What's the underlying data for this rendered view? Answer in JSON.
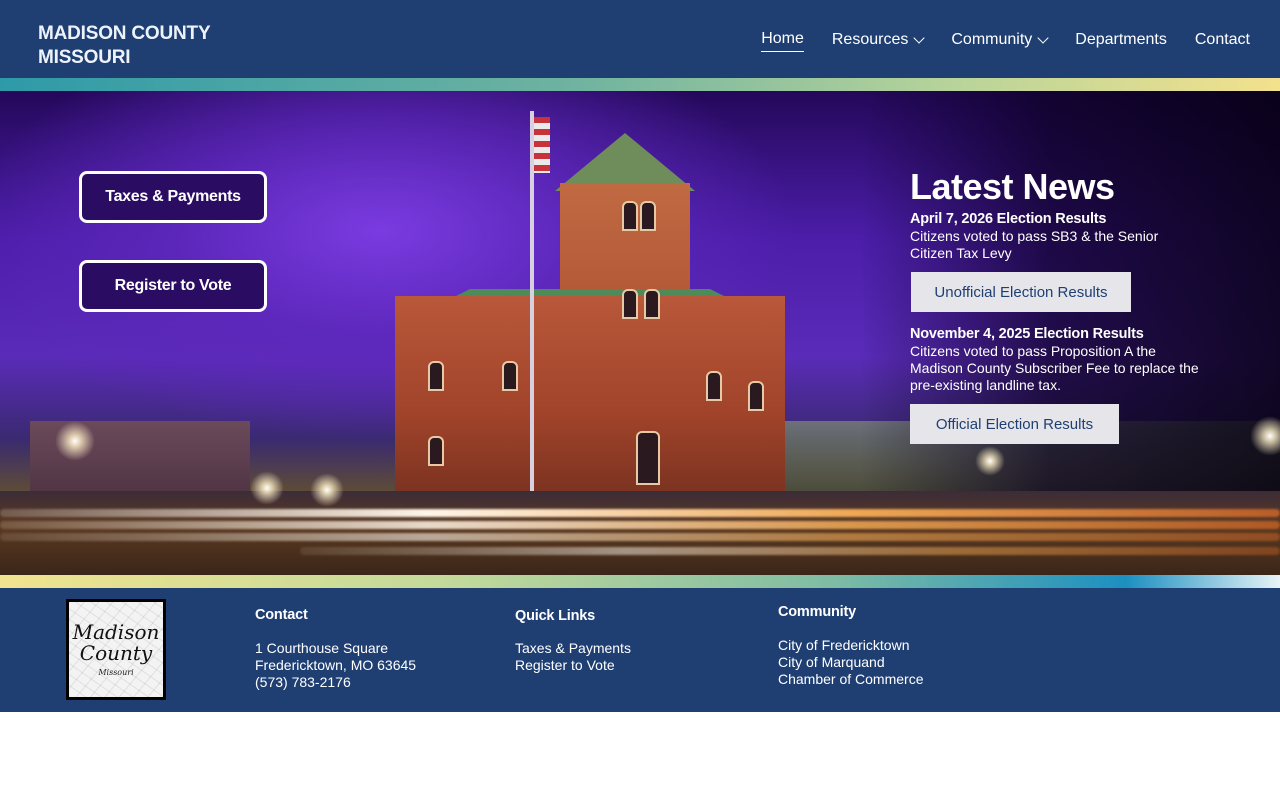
{
  "header": {
    "logo_line1": "MADISON COUNTY",
    "logo_line2": "MISSOURI",
    "nav": [
      {
        "label": "Home",
        "active": true,
        "dropdown": false
      },
      {
        "label": "Resources",
        "active": false,
        "dropdown": true
      },
      {
        "label": "Community",
        "active": false,
        "dropdown": true
      },
      {
        "label": "Departments",
        "active": false,
        "dropdown": false
      },
      {
        "label": "Contact",
        "active": false,
        "dropdown": false
      }
    ]
  },
  "hero": {
    "buttons": [
      "Taxes & Payments",
      "Register to Vote"
    ],
    "news": {
      "title": "Latest News",
      "items": [
        {
          "date": "April 7, 2026 Election Results",
          "text": "Citizens voted to pass SB3 & the Senior Citizen Tax Levy",
          "button": "Unofficial Election Results"
        },
        {
          "date": "November 4, 2025 Election Results",
          "text": "Citizens voted to pass Proposition A the Madison County Subscriber Fee to replace the pre-existing landline tax.",
          "button": "Official Election Results"
        }
      ]
    }
  },
  "footer": {
    "seal": {
      "line1": "Madison",
      "line2": "County",
      "sub": "Missouri"
    },
    "contact": {
      "heading": "Contact",
      "lines": [
        "1 Courthouse Square",
        "Fredericktown, MO 63645",
        "(573) 783-2176"
      ]
    },
    "quick_links": {
      "heading": "Quick Links",
      "links": [
        "Taxes & Payments",
        "Register to Vote"
      ]
    },
    "community": {
      "heading": "Community",
      "links": [
        "City of Fredericktown",
        "City of Marquand",
        "Chamber of Commerce"
      ]
    }
  },
  "colors": {
    "header_bg": "#1f3f73",
    "button_bg": "#2a0d62",
    "news_button_bg": "#e6e6ea"
  }
}
